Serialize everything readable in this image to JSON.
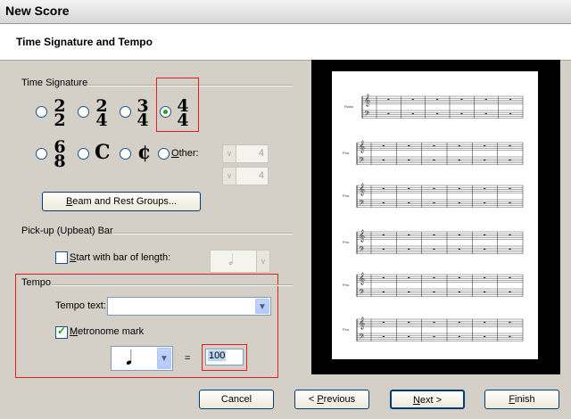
{
  "window": {
    "title": "New Score"
  },
  "header": {
    "title": "Time Signature and Tempo"
  },
  "time_signature": {
    "label": "Time Signature",
    "options": [
      {
        "top": "2",
        "bottom": "2"
      },
      {
        "top": "2",
        "bottom": "4"
      },
      {
        "top": "3",
        "bottom": "4"
      },
      {
        "top": "4",
        "bottom": "4"
      }
    ],
    "selected": "4/4",
    "row2": {
      "six_eight_top": "6",
      "six_eight_bottom": "8",
      "common": "C",
      "cut": "¢"
    },
    "other_label_u": "O",
    "other_label_rest": "ther:",
    "other_top_value": "4",
    "other_bottom_value": "4",
    "beam_button_u": "B",
    "beam_button_rest": "eam and Rest Groups..."
  },
  "pickup": {
    "label": "Pick-up (Upbeat) Bar",
    "checkbox_u": "S",
    "checkbox_rest": "tart with bar of length:",
    "checked": false,
    "note_icon": "half-note-icon"
  },
  "tempo": {
    "label": "Tempo",
    "tempo_text_label": "Tempo text:",
    "tempo_text_value": "",
    "metronome_u": "M",
    "metronome_rest": "etronome mark",
    "metronome_checked": true,
    "note_icon": "quarter-note-icon",
    "equals": "=",
    "bpm": "100"
  },
  "preview": {
    "staff_label_first": "Piano",
    "staff_label": "Pno."
  },
  "buttons": {
    "cancel": "Cancel",
    "previous_pre": "< ",
    "previous_u": "P",
    "previous_rest": "revious",
    "next_u": "N",
    "next_rest": "ext >",
    "finish_u": "F",
    "finish_rest": "inish"
  },
  "colors": {
    "highlight": "#e02020",
    "radio_dot": "#21a121",
    "check": "#21a121"
  }
}
